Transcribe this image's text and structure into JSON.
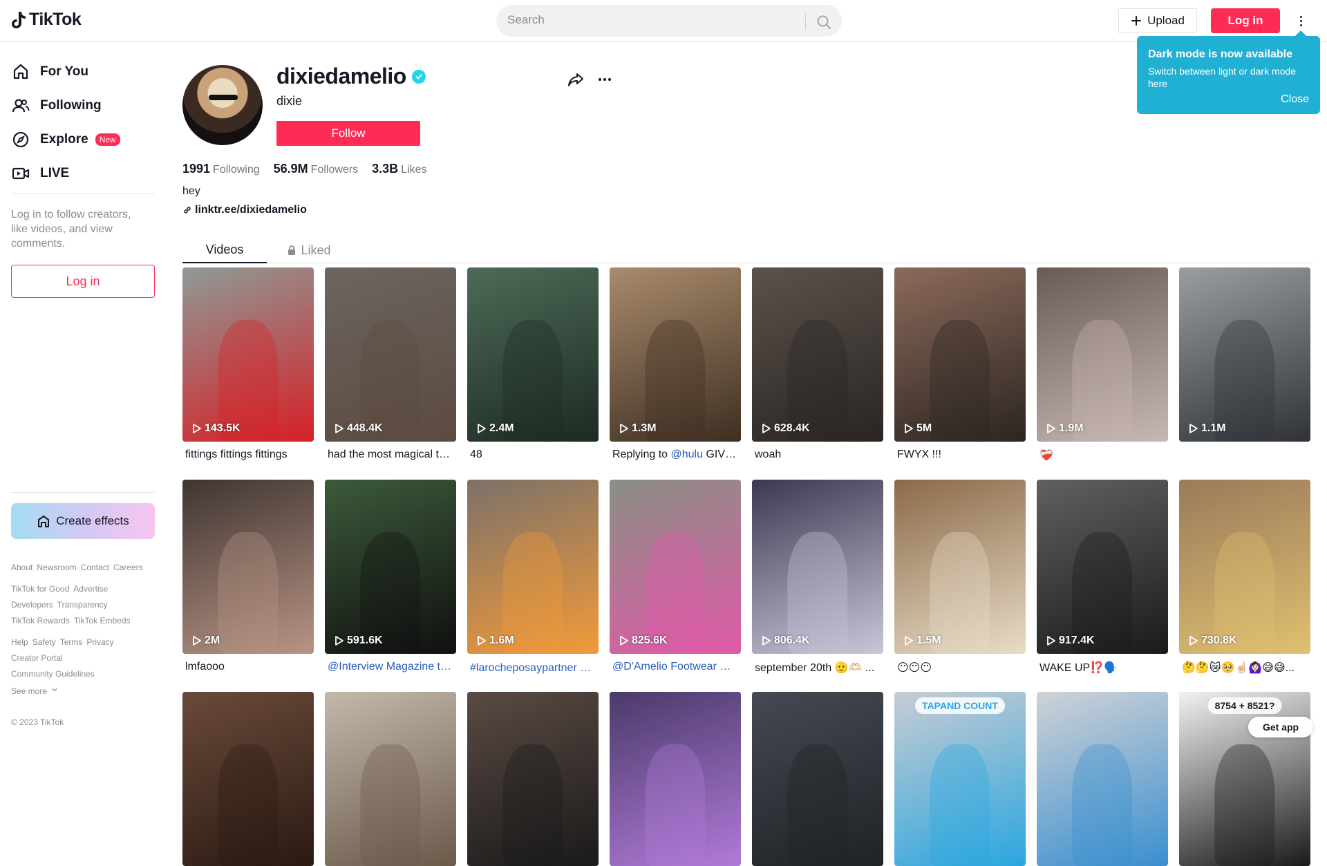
{
  "header": {
    "logo_text": "TikTok",
    "search_placeholder": "Search",
    "upload_label": "Upload",
    "login_label": "Log in"
  },
  "tooltip": {
    "title": "Dark mode is now available",
    "body": "Switch between light or dark mode here",
    "close": "Close"
  },
  "sidebar": {
    "items": [
      {
        "label": "For You",
        "icon": "home-icon"
      },
      {
        "label": "Following",
        "icon": "people-icon"
      },
      {
        "label": "Explore",
        "icon": "compass-icon",
        "badge": "New"
      },
      {
        "label": "LIVE",
        "icon": "live-camera-icon"
      }
    ],
    "login_hint": "Log in to follow creators, like videos, and view comments.",
    "login_button": "Log in",
    "create_effects": "Create effects",
    "footer_rows": [
      [
        "About",
        "Newsroom",
        "Contact",
        "Careers"
      ],
      [
        "TikTok for Good",
        "Advertise"
      ],
      [
        "Developers",
        "Transparency"
      ],
      [
        "TikTok Rewards",
        "TikTok Embeds"
      ],
      [
        "Help",
        "Safety",
        "Terms",
        "Privacy"
      ],
      [
        "Creator Portal"
      ],
      [
        "Community Guidelines"
      ],
      [
        "See more"
      ]
    ],
    "copyright": "© 2023 TikTok"
  },
  "profile": {
    "username": "dixiedamelio",
    "nickname": "dixie",
    "follow_label": "Follow",
    "following_count": "1991",
    "following_label": "Following",
    "followers_count": "56.9M",
    "followers_label": "Followers",
    "likes_count": "3.3B",
    "likes_label": "Likes",
    "bio": "hey",
    "link": "linktr.ee/dixiedamelio"
  },
  "tabs": {
    "videos": "Videos",
    "liked": "Liked"
  },
  "videos": [
    {
      "views": "143.5K",
      "caption": "fittings fittings fittings",
      "color": "#8f9a96",
      "accent": "#d61f26"
    },
    {
      "views": "448.4K",
      "caption": "had the most magical time in...",
      "color": "#6c6560",
      "accent": "#5b4a40"
    },
    {
      "views": "2.4M",
      "caption": "48",
      "color": "#4d6b58",
      "accent": "#1d2a22"
    },
    {
      "views": "1.3M",
      "caption": "Replying to @hulu GIVE THE...",
      "color": "#a98b6c",
      "accent": "#3e2f22"
    },
    {
      "views": "628.4K",
      "caption": "woah",
      "color": "#5a524c",
      "accent": "#2a2522"
    },
    {
      "views": "5M",
      "caption": "FWYX !!!",
      "color": "#8c6a5a",
      "accent": "#2b2522"
    },
    {
      "views": "1.9M",
      "caption": "❤️‍🩹",
      "color": "#6a5a56",
      "accent": "#c8b8b4"
    },
    {
      "views": "1.1M",
      "caption": "",
      "color": "#9a9ea3",
      "accent": "#2f3236"
    },
    {
      "views": "2M",
      "caption": "lmfaooo",
      "color": "#3f3532",
      "accent": "#b89484"
    },
    {
      "views": "591.6K",
      "caption": "@Interview Magazine thank...",
      "color": "#3c5a3a",
      "accent": "#101010"
    },
    {
      "views": "1.6M",
      "caption": "#larocheposaypartner 🧴...",
      "color": "#7c7168",
      "accent": "#f29a3a"
    },
    {
      "views": "825.6K",
      "caption": "@D'Amelio Footwear pink...",
      "color": "#8a8f84",
      "accent": "#e05aa8"
    },
    {
      "views": "806.4K",
      "caption": "september 20th 🫡🫶🏻 ...",
      "color": "#3d3850",
      "accent": "#c9c6da"
    },
    {
      "views": "1.5M",
      "caption": "😶😶😶",
      "color": "#8b6a48",
      "accent": "#e8dcc8"
    },
    {
      "views": "917.4K",
      "caption": "WAKE UP⁉️🗣️",
      "color": "#60615f",
      "accent": "#1a1a1a"
    },
    {
      "views": "730.8K",
      "caption": "🤔🤔😿🥺☝🏻🙆🏻‍♀️😅😅...",
      "color": "#9a7a5a",
      "accent": "#e0c070"
    },
    {
      "views": "",
      "caption": "",
      "color": "#6a4a3a",
      "accent": "#2a1a12"
    },
    {
      "views": "",
      "caption": "",
      "color": "#c4b8ac",
      "accent": "#6a5a4a"
    },
    {
      "views": "",
      "caption": "",
      "color": "#5a4a44",
      "accent": "#1a1a1a"
    },
    {
      "views": "",
      "caption": "",
      "color": "#4a3a6a",
      "accent": "#b07ad8"
    },
    {
      "views": "",
      "caption": "",
      "color": "#454a52",
      "accent": "#1f2226"
    },
    {
      "views": "",
      "caption": "",
      "color": "#c8ccd2",
      "accent": "#2aa6e0",
      "overlay": "TAPAND COUNT"
    },
    {
      "views": "",
      "caption": "",
      "color": "#cfd2d6",
      "accent": "#3a8fd0"
    },
    {
      "views": "",
      "caption": "",
      "color": "#f2f2f2",
      "accent": "#1a1a1a",
      "overlay": "8754 + 8521?"
    }
  ],
  "get_app": "Get app"
}
